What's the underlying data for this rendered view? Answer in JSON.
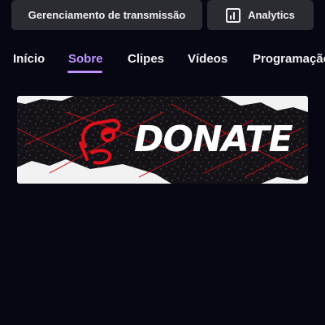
{
  "toolbar": {
    "stream_manager_label": "Gerenciamento de transmissão",
    "analytics_label": "Analytics",
    "analytics_icon": "bar-chart-icon"
  },
  "tabs": [
    {
      "label": "Início",
      "active": false
    },
    {
      "label": "Sobre",
      "active": true
    },
    {
      "label": "Clipes",
      "active": false
    },
    {
      "label": "Vídeos",
      "active": false
    },
    {
      "label": "Programação",
      "active": false
    }
  ],
  "panel": {
    "banner_text": "DONATE",
    "banner_icon": "hand-coin-icon"
  },
  "colors": {
    "background": "#070613",
    "button_bg": "#2b2b32",
    "accent": "#bf94ff",
    "banner_red": "#e0101a"
  }
}
